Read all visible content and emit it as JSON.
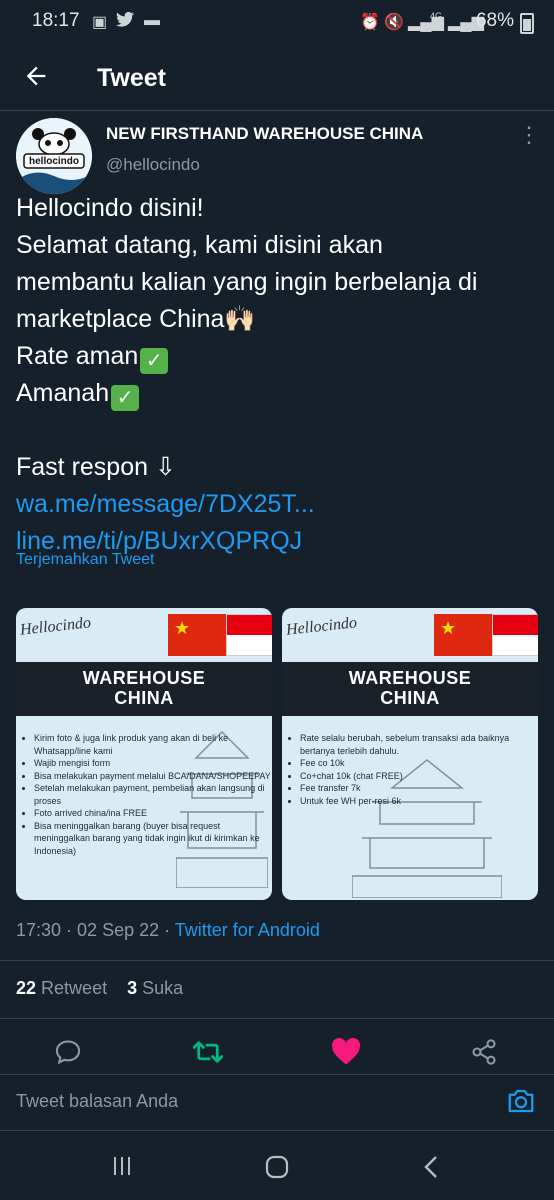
{
  "status": {
    "time": "18:17",
    "battery": "68%",
    "network": "4G"
  },
  "header": {
    "title": "Tweet"
  },
  "author": {
    "name": "NEW FIRSTHAND WAREHOUSE CHINA",
    "handle": "@hellocindo",
    "avatar_text": "hellocindo"
  },
  "tweet": {
    "lines": [
      "Hellocindo disini!",
      "Selamat datang, kami disini akan",
      "membantu kalian yang ingin berbelanja di",
      "marketplace China🙌🏻",
      "Rate aman",
      "Amanah",
      "",
      "Fast respon ⇩"
    ],
    "links": [
      "wa.me/message/7DX25T...",
      "line.me/ti/p/BUxrXQPRQJ"
    ],
    "translate": "Terjemahkan Tweet"
  },
  "images": [
    {
      "brand": "Hellocindo",
      "banner_line1": "WAREHOUSE",
      "banner_line2": "CHINA",
      "bullets": [
        "Kirim foto & juga link produk yang akan di beli ke Whatsapp/line kami",
        "Wajib mengisi form",
        "Bisa melakukan payment melalui BCA/DANA/SHOPEEPAY",
        "Setelah melakukan payment, pembelian akan langsung di proses",
        "Foto arrived china/ina FREE",
        "Bisa meninggalkan barang (buyer bisa request meninggalkan barang yang tidak ingin ikut di kirimkan ke Indonesia)"
      ]
    },
    {
      "brand": "Hellocindo",
      "banner_line1": "WAREHOUSE",
      "banner_line2": "CHINA",
      "bullets": [
        "Rate selalu berubah, sebelum transaksi ada baiknya bertanya terlebih dahulu.",
        "Fee co 10k",
        "Co+chat 10k (chat FREE)",
        "Fee transfer 7k",
        "Untuk fee WH per-resi 6k"
      ]
    }
  ],
  "meta": {
    "time": "17:30",
    "date": "02 Sep 22",
    "sep": " · ",
    "source": "Twitter for Android"
  },
  "stats": {
    "retweets": "22",
    "retweets_label": "Retweet",
    "likes": "3",
    "likes_label": "Suka"
  },
  "reply": {
    "placeholder": "Tweet balasan Anda"
  },
  "colors": {
    "background": "#15202b",
    "accent": "#1d9bf0",
    "retweet": "#00ba7c",
    "like": "#f91880",
    "muted": "#8b98a5"
  },
  "icons": [
    "back-arrow-icon",
    "more-icon",
    "reply-icon",
    "retweet-icon",
    "like-heart-icon",
    "share-icon",
    "camera-icon"
  ]
}
